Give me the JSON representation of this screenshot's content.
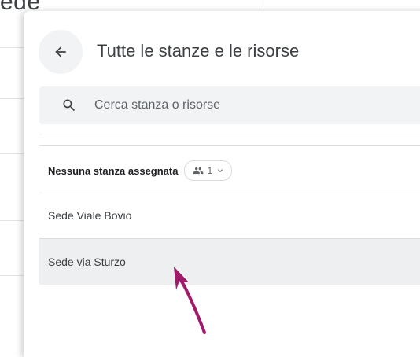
{
  "background": {
    "partial_text": "ede"
  },
  "panel": {
    "back_icon": "arrow-left-icon",
    "title": "Tutte le stanze e le risorse",
    "search": {
      "placeholder": "Cerca stanza o risorse",
      "icon": "search-icon"
    },
    "group_header": {
      "label": "Nessuna stanza assegnata",
      "chip": {
        "count": "1",
        "icon": "people-icon",
        "chevron": "chevron-down-icon"
      }
    },
    "rooms": [
      {
        "label": "Sede Viale Bovio",
        "selected": false
      },
      {
        "label": "Sede via Sturzo",
        "selected": true
      }
    ]
  },
  "annotation": {
    "type": "hand-drawn-arrow",
    "color": "#a01a6b"
  }
}
